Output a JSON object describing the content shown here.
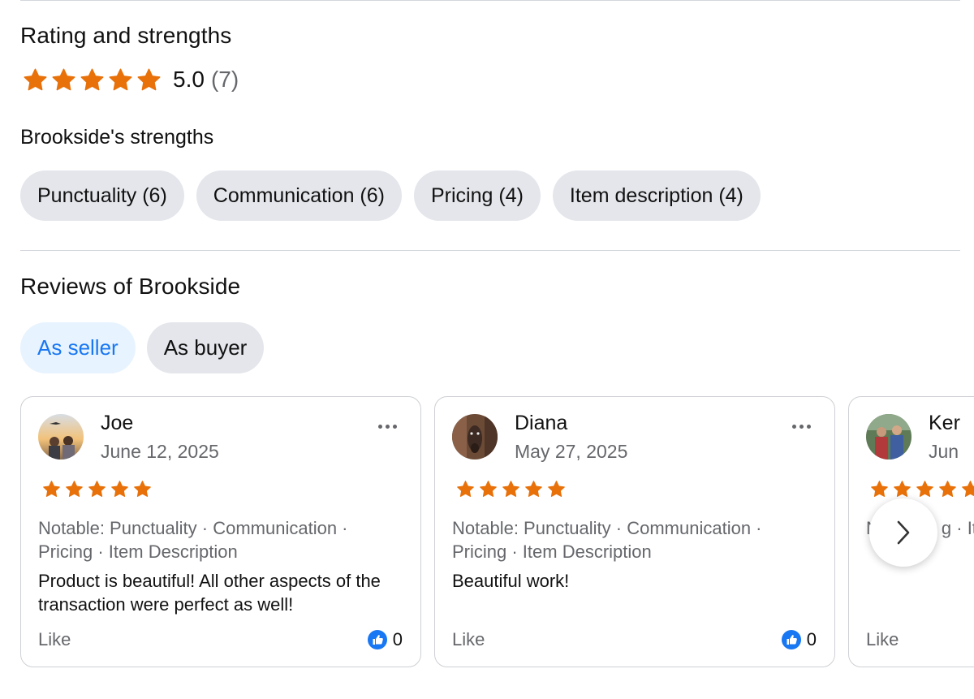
{
  "rating_section": {
    "title": "Rating and strengths",
    "score": "5.0",
    "count": "(7)",
    "stars": 5,
    "star_color": "#e8710a"
  },
  "strengths": {
    "title": "Brookside's strengths",
    "chips": [
      {
        "label": "Punctuality (6)"
      },
      {
        "label": "Communication (6)"
      },
      {
        "label": "Pricing (4)"
      },
      {
        "label": "Item description (4)"
      }
    ]
  },
  "reviews": {
    "title": "Reviews of Brookside",
    "tabs": [
      {
        "label": "As seller",
        "active": true
      },
      {
        "label": "As buyer",
        "active": false
      }
    ],
    "cards": [
      {
        "name": "Joe",
        "date": "June 12, 2025",
        "stars": 5,
        "notable": "Notable: Punctuality · Communication · Pricing · Item Description",
        "comment": "Product is beautiful! All other aspects of the transaction were perfect as well!",
        "like_label": "Like",
        "like_count": "0"
      },
      {
        "name": "Diana",
        "date": "May 27, 2025",
        "stars": 5,
        "notable": "Notable: Punctuality · Communication · Pricing · Item Description",
        "comment": "Beautiful work!",
        "like_label": "Like",
        "like_count": "0"
      },
      {
        "name": "Ker",
        "date": "Jun",
        "stars": 5,
        "notable": "N     Pu · g · It",
        "comment": "",
        "like_label": "Like",
        "like_count": ""
      }
    ]
  },
  "icons": {
    "star": "star-icon",
    "more": "more-horizontal-icon",
    "thumbs_up": "thumbs-up-icon",
    "next": "chevron-right-icon"
  },
  "colors": {
    "accent_blue": "#1877f2",
    "chip_bg": "#e4e6eb",
    "active_tab_bg": "#e7f3ff",
    "muted_text": "#65676b"
  }
}
